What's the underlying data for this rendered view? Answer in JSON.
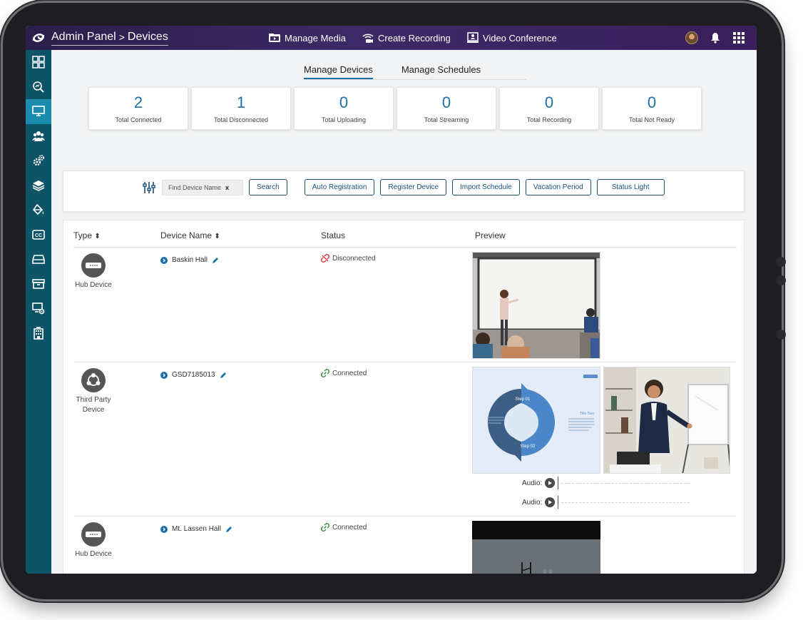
{
  "header": {
    "app_title": "Admin Panel",
    "separator": ">",
    "page": "Devices",
    "nav": [
      {
        "label": "Manage Media",
        "icon": "media-folder-icon"
      },
      {
        "label": "Create Recording",
        "icon": "broadcast-icon"
      },
      {
        "label": "Video Conference",
        "icon": "video-conference-icon"
      }
    ]
  },
  "sidebar": {
    "items": [
      {
        "icon": "dashboard-grid-icon",
        "active": false
      },
      {
        "icon": "search-analytics-icon",
        "active": false
      },
      {
        "icon": "monitor-icon",
        "active": true
      },
      {
        "icon": "users-group-icon",
        "active": false
      },
      {
        "icon": "settings-gears-icon",
        "active": false
      },
      {
        "icon": "layers-icon",
        "active": false
      },
      {
        "icon": "paint-bucket-icon",
        "active": false
      },
      {
        "icon": "closed-caption-icon",
        "active": false
      },
      {
        "icon": "storage-drive-icon",
        "active": false
      },
      {
        "icon": "archive-box-icon",
        "active": false
      },
      {
        "icon": "device-settings-icon",
        "active": false
      },
      {
        "icon": "building-icon",
        "active": false
      }
    ]
  },
  "tabs": [
    {
      "label": "Manage Devices",
      "active": true
    },
    {
      "label": "Manage Schedules",
      "active": false
    }
  ],
  "stats": [
    {
      "value": "2",
      "label": "Total Connected"
    },
    {
      "value": "1",
      "label": "Total Disconnected"
    },
    {
      "value": "0",
      "label": "Total Uploading"
    },
    {
      "value": "0",
      "label": "Total Streaming"
    },
    {
      "value": "0",
      "label": "Total Recording"
    },
    {
      "value": "0",
      "label": "Total Not Ready"
    }
  ],
  "toolbar": {
    "find_label": "Find Device Name",
    "clear_label": "x",
    "search": "Search",
    "auto_registration": "Auto Registration",
    "register_device": "Register Device",
    "import_schedule": "Import Schedule",
    "vacation_period": "Vacation Period",
    "status_light": "Status Light"
  },
  "table": {
    "columns": [
      "Type",
      "Device Name",
      "Status",
      "Preview"
    ],
    "sort_glyph": "⬍",
    "rows": [
      {
        "type": "Hub Device",
        "name": "Baskin Hall",
        "status": "Disconnected"
      },
      {
        "type": "Third Party Device",
        "name": "GSD7185013",
        "status": "Connected",
        "audio": [
          "Audio:",
          "Audio:"
        ]
      },
      {
        "type": "Hub Device",
        "name": "Mt. Lassen Hall",
        "status": "Connected"
      }
    ]
  },
  "slide": {
    "step1": "Step 01",
    "step2": "Step 02",
    "title_two": "Title Two"
  },
  "colors": {
    "header_start": "#2a1f4a",
    "rail": "#0e5467",
    "rail_active": "#1b8cad",
    "accent": "#1b6fa8",
    "disconnected": "#d9363e",
    "connected": "#3b8a3e"
  }
}
